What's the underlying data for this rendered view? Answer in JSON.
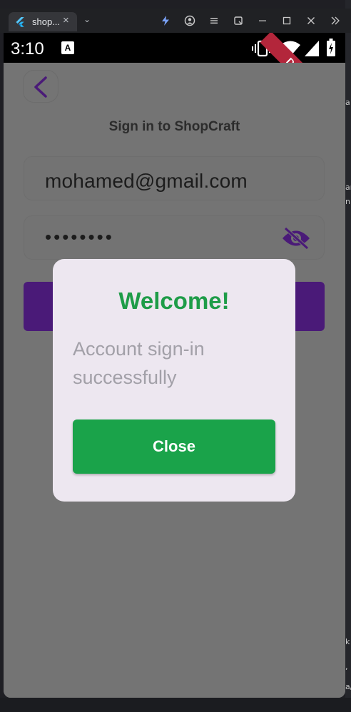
{
  "browser": {
    "tab_title": "shop...",
    "tab_close": "×",
    "dropdown": "⌄"
  },
  "status_bar": {
    "time": "3:10",
    "a_badge": "A",
    "debug_label": "DEBUG"
  },
  "screen": {
    "heading": "Sign in to ShopCraft",
    "email_value": "mohamed@gmail.com",
    "password_value": "••••••••"
  },
  "dialog": {
    "title": "Welcome!",
    "message": "Account sign-in successfully",
    "close_label": "Close"
  },
  "colors": {
    "accent_purple": "#6d2ab2",
    "success_green": "#1aa34a",
    "debug_red": "#b3263b"
  },
  "host_text_fragments": [
    "a",
    "ar",
    "n",
    "k",
    ",",
    "a/"
  ]
}
